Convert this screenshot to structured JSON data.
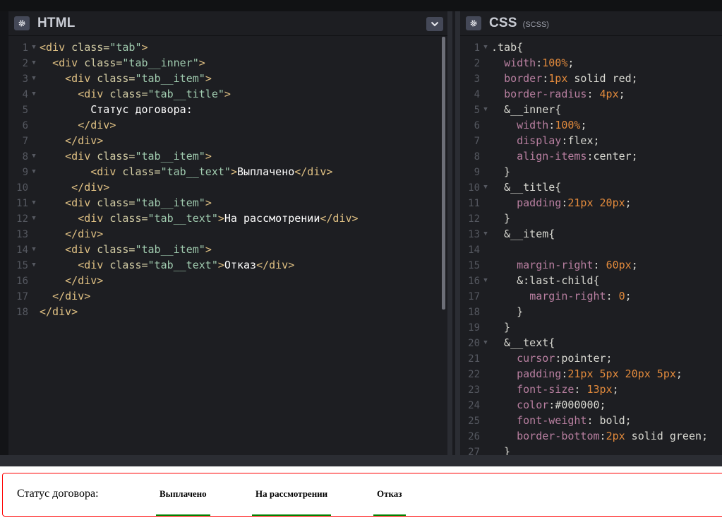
{
  "panels": {
    "html": {
      "title": "HTML",
      "lines": [
        {
          "n": "1",
          "fold": true,
          "segs": [
            [
              "t",
              "<div "
            ],
            [
              "a",
              "class="
            ],
            [
              "s",
              "\"tab\""
            ],
            [
              "t",
              ">"
            ]
          ]
        },
        {
          "n": "2",
          "fold": true,
          "segs": [
            [
              "v",
              "  "
            ],
            [
              "t",
              "<div "
            ],
            [
              "a",
              "class="
            ],
            [
              "s",
              "\"tab__inner\""
            ],
            [
              "t",
              ">"
            ]
          ]
        },
        {
          "n": "3",
          "fold": true,
          "segs": [
            [
              "v",
              "    "
            ],
            [
              "t",
              "<div "
            ],
            [
              "a",
              "class="
            ],
            [
              "s",
              "\"tab__item\""
            ],
            [
              "t",
              ">"
            ]
          ]
        },
        {
          "n": "4",
          "fold": true,
          "segs": [
            [
              "v",
              "      "
            ],
            [
              "t",
              "<div "
            ],
            [
              "a",
              "class="
            ],
            [
              "s",
              "\"tab__title\""
            ],
            [
              "t",
              ">"
            ]
          ]
        },
        {
          "n": "5",
          "fold": false,
          "segs": [
            [
              "txt",
              "        Статус договора:"
            ]
          ]
        },
        {
          "n": "6",
          "fold": false,
          "segs": [
            [
              "v",
              "      "
            ],
            [
              "t",
              "</div>"
            ]
          ]
        },
        {
          "n": "7",
          "fold": false,
          "segs": [
            [
              "v",
              "    "
            ],
            [
              "t",
              "</div>"
            ]
          ]
        },
        {
          "n": "8",
          "fold": true,
          "segs": [
            [
              "v",
              "    "
            ],
            [
              "t",
              "<div "
            ],
            [
              "a",
              "class="
            ],
            [
              "s",
              "\"tab__item\""
            ],
            [
              "t",
              ">"
            ]
          ]
        },
        {
          "n": "9",
          "fold": true,
          "segs": [
            [
              "v",
              "        "
            ],
            [
              "t",
              "<div "
            ],
            [
              "a",
              "class="
            ],
            [
              "s",
              "\"tab__text\""
            ],
            [
              "t",
              ">"
            ],
            [
              "txt",
              "Выплачено"
            ],
            [
              "t",
              "</div>"
            ]
          ]
        },
        {
          "n": "10",
          "fold": false,
          "segs": [
            [
              "v",
              "     "
            ],
            [
              "t",
              "</div>"
            ]
          ]
        },
        {
          "n": "11",
          "fold": true,
          "segs": [
            [
              "v",
              "    "
            ],
            [
              "t",
              "<div "
            ],
            [
              "a",
              "class="
            ],
            [
              "s",
              "\"tab__item\""
            ],
            [
              "t",
              ">"
            ]
          ]
        },
        {
          "n": "12",
          "fold": true,
          "segs": [
            [
              "v",
              "      "
            ],
            [
              "t",
              "<div "
            ],
            [
              "a",
              "class="
            ],
            [
              "s",
              "\"tab__text\""
            ],
            [
              "t",
              ">"
            ],
            [
              "txt",
              "На рассмотрении"
            ],
            [
              "t",
              "</div>"
            ]
          ]
        },
        {
          "n": "13",
          "fold": false,
          "segs": [
            [
              "v",
              "    "
            ],
            [
              "t",
              "</div>"
            ]
          ]
        },
        {
          "n": "14",
          "fold": true,
          "segs": [
            [
              "v",
              "    "
            ],
            [
              "t",
              "<div "
            ],
            [
              "a",
              "class="
            ],
            [
              "s",
              "\"tab__item\""
            ],
            [
              "t",
              ">"
            ]
          ]
        },
        {
          "n": "15",
          "fold": true,
          "segs": [
            [
              "v",
              "      "
            ],
            [
              "t",
              "<div "
            ],
            [
              "a",
              "class="
            ],
            [
              "s",
              "\"tab__text\""
            ],
            [
              "t",
              ">"
            ],
            [
              "txt",
              "Отказ"
            ],
            [
              "t",
              "</div>"
            ]
          ]
        },
        {
          "n": "16",
          "fold": false,
          "segs": [
            [
              "v",
              "    "
            ],
            [
              "t",
              "</div>"
            ]
          ]
        },
        {
          "n": "17",
          "fold": false,
          "segs": [
            [
              "v",
              "  "
            ],
            [
              "t",
              "</div>"
            ]
          ]
        },
        {
          "n": "18",
          "fold": false,
          "segs": [
            [
              "t",
              "</div>"
            ]
          ]
        }
      ]
    },
    "css": {
      "title": "CSS",
      "subtitle": "(SCSS)",
      "lines": [
        {
          "n": "1",
          "fold": true,
          "segs": [
            [
              "v",
              ".tab{"
            ]
          ]
        },
        {
          "n": "2",
          "fold": false,
          "segs": [
            [
              "v",
              "  "
            ],
            [
              "p",
              "width"
            ],
            [
              "v",
              ":"
            ],
            [
              "n",
              "100%"
            ],
            [
              "v",
              ";"
            ]
          ]
        },
        {
          "n": "3",
          "fold": false,
          "segs": [
            [
              "v",
              "  "
            ],
            [
              "p",
              "border"
            ],
            [
              "v",
              ":"
            ],
            [
              "n",
              "1px"
            ],
            [
              "v",
              " solid red;"
            ]
          ]
        },
        {
          "n": "4",
          "fold": false,
          "segs": [
            [
              "v",
              "  "
            ],
            [
              "p",
              "border-radius"
            ],
            [
              "v",
              ": "
            ],
            [
              "n",
              "4px"
            ],
            [
              "v",
              ";"
            ]
          ]
        },
        {
          "n": "5",
          "fold": true,
          "segs": [
            [
              "v",
              "  &__inner{"
            ]
          ]
        },
        {
          "n": "6",
          "fold": false,
          "segs": [
            [
              "v",
              "    "
            ],
            [
              "p",
              "width"
            ],
            [
              "v",
              ":"
            ],
            [
              "n",
              "100%"
            ],
            [
              "v",
              ";"
            ]
          ]
        },
        {
          "n": "7",
          "fold": false,
          "segs": [
            [
              "v",
              "    "
            ],
            [
              "p",
              "display"
            ],
            [
              "v",
              ":flex;"
            ]
          ]
        },
        {
          "n": "8",
          "fold": false,
          "segs": [
            [
              "v",
              "    "
            ],
            [
              "p",
              "align-items"
            ],
            [
              "v",
              ":center;"
            ]
          ]
        },
        {
          "n": "9",
          "fold": false,
          "segs": [
            [
              "v",
              "  }"
            ]
          ]
        },
        {
          "n": "10",
          "fold": true,
          "segs": [
            [
              "v",
              "  &__title{"
            ]
          ]
        },
        {
          "n": "11",
          "fold": false,
          "segs": [
            [
              "v",
              "    "
            ],
            [
              "p",
              "padding"
            ],
            [
              "v",
              ":"
            ],
            [
              "n",
              "21px 20px"
            ],
            [
              "v",
              ";"
            ]
          ]
        },
        {
          "n": "12",
          "fold": false,
          "segs": [
            [
              "v",
              "  }"
            ]
          ]
        },
        {
          "n": "13",
          "fold": true,
          "segs": [
            [
              "v",
              "  &__item{"
            ]
          ]
        },
        {
          "n": "14",
          "fold": false,
          "segs": [
            [
              "v",
              ""
            ]
          ]
        },
        {
          "n": "15",
          "fold": false,
          "segs": [
            [
              "v",
              "    "
            ],
            [
              "p",
              "margin-right"
            ],
            [
              "v",
              ": "
            ],
            [
              "n",
              "60px"
            ],
            [
              "v",
              ";"
            ]
          ]
        },
        {
          "n": "16",
          "fold": true,
          "segs": [
            [
              "v",
              "    &:last-child{"
            ]
          ]
        },
        {
          "n": "17",
          "fold": false,
          "segs": [
            [
              "v",
              "      "
            ],
            [
              "p",
              "margin-right"
            ],
            [
              "v",
              ": "
            ],
            [
              "n",
              "0"
            ],
            [
              "v",
              ";"
            ]
          ]
        },
        {
          "n": "18",
          "fold": false,
          "segs": [
            [
              "v",
              "    }"
            ]
          ]
        },
        {
          "n": "19",
          "fold": false,
          "segs": [
            [
              "v",
              "  }"
            ]
          ]
        },
        {
          "n": "20",
          "fold": true,
          "segs": [
            [
              "v",
              "  &__text{"
            ]
          ]
        },
        {
          "n": "21",
          "fold": false,
          "segs": [
            [
              "v",
              "    "
            ],
            [
              "p",
              "cursor"
            ],
            [
              "v",
              ":pointer;"
            ]
          ]
        },
        {
          "n": "22",
          "fold": false,
          "segs": [
            [
              "v",
              "    "
            ],
            [
              "p",
              "padding"
            ],
            [
              "v",
              ":"
            ],
            [
              "n",
              "21px 5px 20px 5px"
            ],
            [
              "v",
              ";"
            ]
          ]
        },
        {
          "n": "23",
          "fold": false,
          "segs": [
            [
              "v",
              "    "
            ],
            [
              "p",
              "font-size"
            ],
            [
              "v",
              ": "
            ],
            [
              "n",
              "13px"
            ],
            [
              "v",
              ";"
            ]
          ]
        },
        {
          "n": "24",
          "fold": false,
          "segs": [
            [
              "v",
              "    "
            ],
            [
              "p",
              "color"
            ],
            [
              "v",
              ":#000000;"
            ]
          ]
        },
        {
          "n": "25",
          "fold": false,
          "segs": [
            [
              "v",
              "    "
            ],
            [
              "p",
              "font-weight"
            ],
            [
              "v",
              ": bold;"
            ]
          ]
        },
        {
          "n": "26",
          "fold": false,
          "segs": [
            [
              "v",
              "    "
            ],
            [
              "p",
              "border-bottom"
            ],
            [
              "v",
              ":"
            ],
            [
              "n",
              "2px"
            ],
            [
              "v",
              " solid green;"
            ]
          ]
        },
        {
          "n": "27",
          "fold": false,
          "segs": [
            [
              "v",
              "  }"
            ]
          ]
        }
      ]
    }
  },
  "preview": {
    "title": "Статус договора:",
    "tabs": [
      "Выплачено",
      "На рассмотрении",
      "Отказ"
    ]
  },
  "colors": {
    "tag": "#dfc083",
    "attr": "#d3cda5",
    "string": "#a0cbaf",
    "property": "#b87fa0",
    "number": "#e28a3c",
    "border_red": "#ff0000",
    "underline_green": "#008000"
  },
  "icons": {
    "settings": "gear-icon",
    "collapse": "chevron-down-icon"
  }
}
